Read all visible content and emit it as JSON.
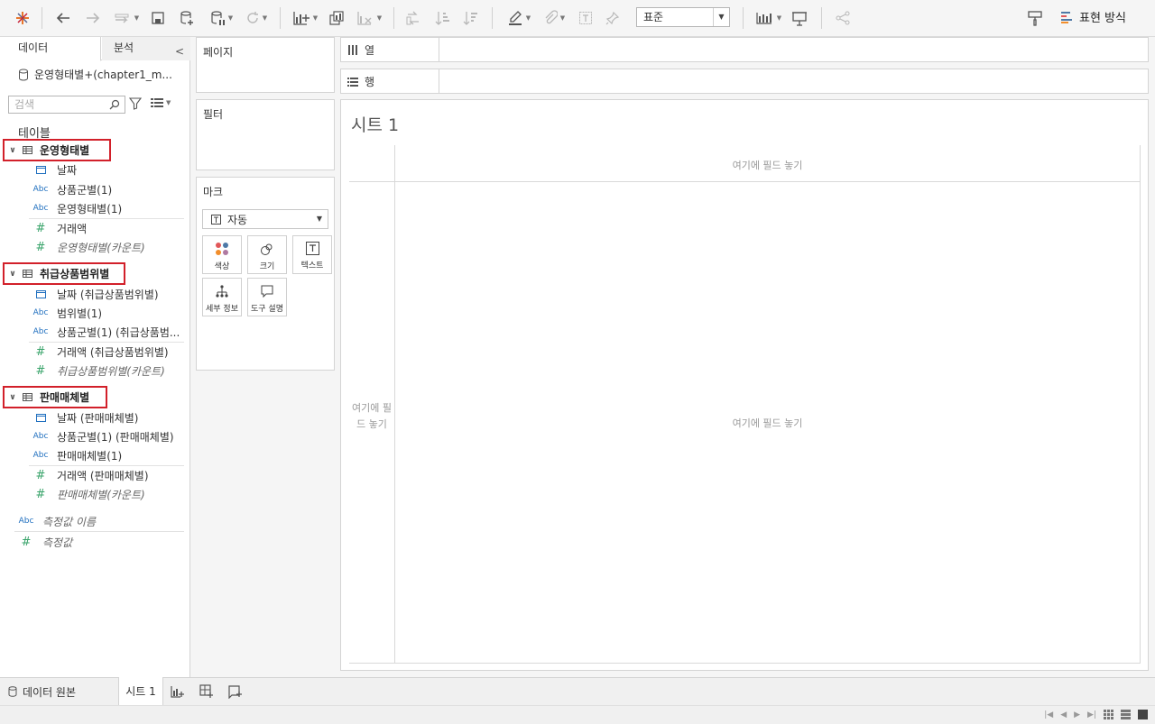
{
  "toolbar": {
    "fit_select": "표준",
    "show_me": "표현 방식"
  },
  "left": {
    "tab_data": "데이터",
    "tab_analysis": "분석",
    "datasource": "운영형태별+(chapter1_m...",
    "search_placeholder": "검색",
    "tables_header": "테이블",
    "tables": [
      {
        "name": "운영형태별",
        "fields": [
          {
            "type": "date",
            "label": "날짜"
          },
          {
            "type": "abc",
            "label": "상품군별(1)"
          },
          {
            "type": "abc",
            "label": "운영형태별(1)"
          },
          {
            "type": "num",
            "label": "거래액"
          },
          {
            "type": "num",
            "label": "운영형태별(카운트)",
            "italic": true
          }
        ]
      },
      {
        "name": "취급상품범위별",
        "fields": [
          {
            "type": "date",
            "label": "날짜 (취급상품범위별)"
          },
          {
            "type": "abc",
            "label": "범위별(1)"
          },
          {
            "type": "abc",
            "label": "상품군별(1) (취급상품범..."
          },
          {
            "type": "num",
            "label": "거래액 (취급상품범위별)"
          },
          {
            "type": "num",
            "label": "취급상품범위별(카운트)",
            "italic": true
          }
        ]
      },
      {
        "name": "판매매체별",
        "fields": [
          {
            "type": "date",
            "label": "날짜 (판매매체별)"
          },
          {
            "type": "abc",
            "label": "상품군별(1) (판매매체별)"
          },
          {
            "type": "abc",
            "label": "판매매체별(1)"
          },
          {
            "type": "num",
            "label": "거래액 (판매매체별)"
          },
          {
            "type": "num",
            "label": "판매매체별(카운트)",
            "italic": true
          }
        ]
      }
    ],
    "measure_names": "측정값 이름",
    "measure_values": "측정값",
    "abc_glyph": "Abc",
    "num_glyph": "#"
  },
  "cards": {
    "pages": "페이지",
    "filters": "필터",
    "marks": "마크",
    "mark_type": "자동",
    "buttons": {
      "color": "색상",
      "size": "크기",
      "text": "텍스트",
      "detail": "세부 정보",
      "tooltip": "도구 설명"
    }
  },
  "shelves": {
    "columns": "열",
    "rows": "행"
  },
  "sheet": {
    "title": "시트 1",
    "drop_top": "여기에 필드 놓기",
    "drop_left": "여기에 필드 놓기",
    "drop_center": "여기에 필드 놓기"
  },
  "bottom": {
    "datasource_tab": "데이터 원본",
    "sheet_tab": "시트 1"
  }
}
